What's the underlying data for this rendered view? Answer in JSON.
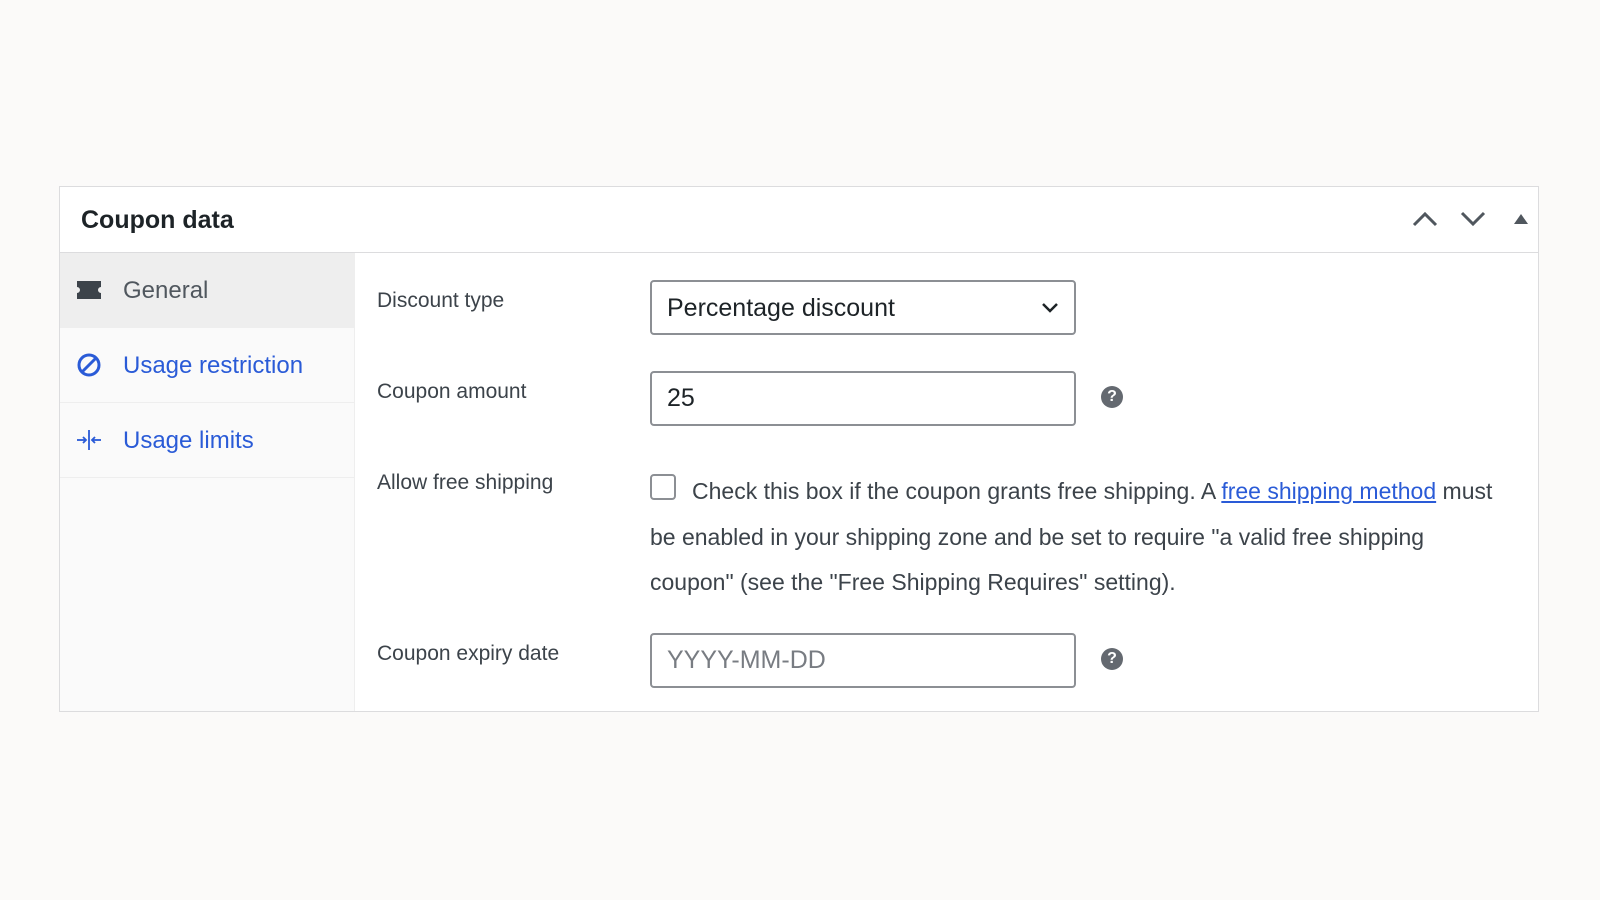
{
  "panel": {
    "title": "Coupon data",
    "header_controls": [
      "move-up",
      "move-down",
      "toggle-panel"
    ]
  },
  "tabs": [
    {
      "label": "General",
      "icon": "ticket-icon",
      "active": true
    },
    {
      "label": "Usage restriction",
      "icon": "ban-icon",
      "active": false
    },
    {
      "label": "Usage limits",
      "icon": "limits-icon",
      "active": false
    }
  ],
  "fields": {
    "discount_type": {
      "label": "Discount type",
      "value": "Percentage discount"
    },
    "coupon_amount": {
      "label": "Coupon amount",
      "value": "25"
    },
    "free_shipping": {
      "label": "Allow free shipping",
      "checked": false,
      "text_before": "Check this box if the coupon grants free shipping. A ",
      "link_text": "free shipping method",
      "text_after": " must be enabled in your shipping zone and be set to require \"a valid free shipping coupon\" (see the \"Free Shipping Requires\" setting)."
    },
    "expiry_date": {
      "label": "Coupon expiry date",
      "placeholder": "YYYY-MM-DD"
    }
  },
  "help_icon_glyph": "?",
  "colors": {
    "link": "#2a5bd7",
    "page_bg": "#fbfaf9",
    "active_tab_bg": "#eeeeee",
    "help_icon": "#646970"
  }
}
